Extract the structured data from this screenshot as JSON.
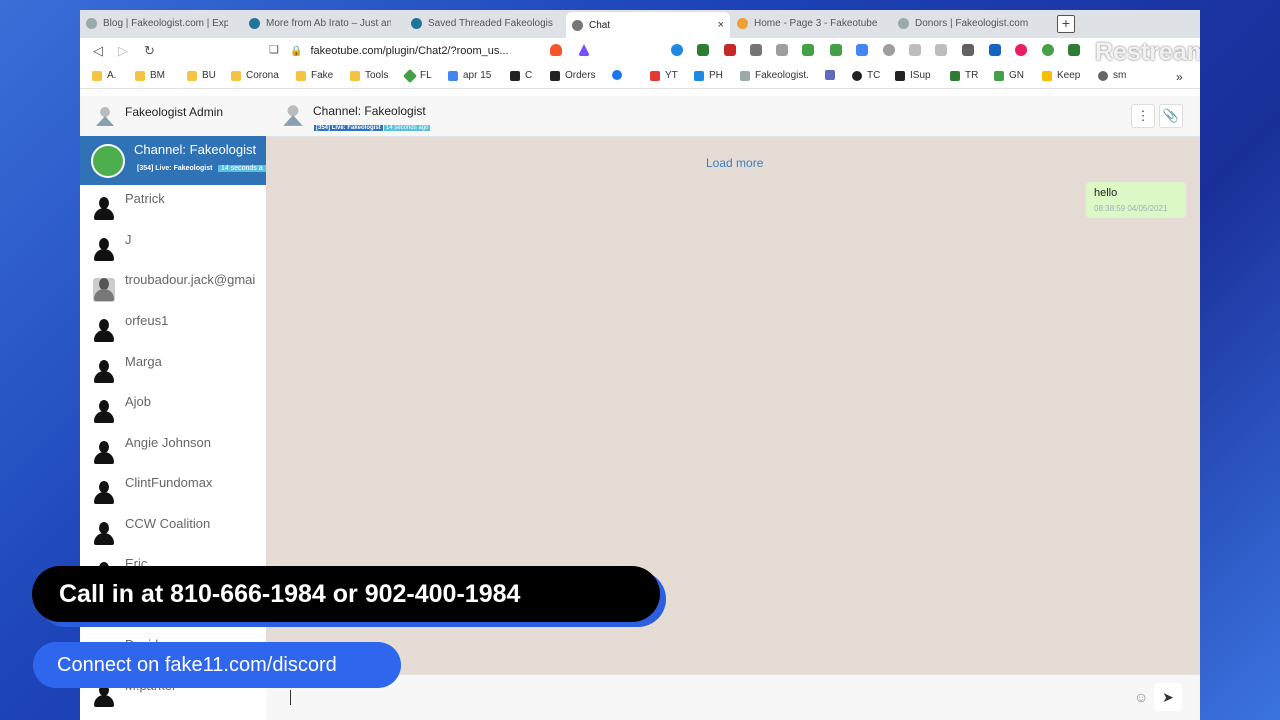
{
  "browser": {
    "tabs": [
      {
        "title": "Blog | Fakeologist.com | Exp",
        "icon": "fakeologist-icon",
        "active": false
      },
      {
        "title": "More from Ab Irato – Just an",
        "icon": "wordpress-icon",
        "active": false
      },
      {
        "title": "Saved Threaded Fakeologist",
        "icon": "wordpress-icon",
        "active": false
      },
      {
        "title": "Chat",
        "icon": "globe-icon",
        "active": true
      },
      {
        "title": "Home - Page 3 - Fakeotube -",
        "icon": "fakeotube-icon",
        "active": false
      },
      {
        "title": "Donors | Fakeologist.com",
        "icon": "fakeologist-icon",
        "active": false
      }
    ],
    "new_tab": "+",
    "close_tab": "×",
    "url": "fakeotube.com/plugin/Chat2/?room_us...",
    "restream_watermark": "Restream",
    "bookmarks": [
      "A.",
      "BM",
      "BU",
      "Corona",
      "Fake",
      "Tools",
      "FL",
      "apr 15",
      "C",
      "Orders",
      "",
      "YT",
      "PH",
      "Fakeologist.",
      "",
      "TC",
      "ISup",
      "TR",
      "GN",
      "Keep",
      "sm"
    ],
    "more_bookmarks": "»"
  },
  "sidebar": {
    "admin_name": "Fakeologist Admin",
    "channel": {
      "name": "Channel: Fakeologist",
      "sub": "[354] Live: Fakeologist",
      "badge": "14 seconds a"
    },
    "contacts": [
      {
        "name": "Patrick",
        "avatar": "silhouette"
      },
      {
        "name": "J",
        "avatar": "silhouette"
      },
      {
        "name": "troubadour.jack@gmai",
        "avatar": "photo"
      },
      {
        "name": "orfeus1",
        "avatar": "silhouette"
      },
      {
        "name": "Marga",
        "avatar": "silhouette"
      },
      {
        "name": "Ajob",
        "avatar": "silhouette"
      },
      {
        "name": "Angie Johnson",
        "avatar": "silhouette"
      },
      {
        "name": "ClintFundomax",
        "avatar": "silhouette"
      },
      {
        "name": "CCW Coalition",
        "avatar": "silhouette"
      },
      {
        "name": "Eric",
        "avatar": "silhouette"
      },
      {
        "name": "",
        "avatar": "silhouette"
      },
      {
        "name": "David",
        "avatar": "silhouette"
      },
      {
        "name": "M.parker",
        "avatar": "silhouette"
      }
    ]
  },
  "chat": {
    "title": "Channel: Fakeologist",
    "sub": "[354] Live: Fakeologist",
    "sub_badge": "14 seconds ago",
    "load_more": "Load more",
    "messages": [
      {
        "text": "hello",
        "time": "08:38:59 04/05/2021",
        "outgoing": true
      }
    ],
    "input_value": ""
  },
  "overlay": {
    "call_in": "Call in at 810-666-1984 or 902-400-1984",
    "discord": "Connect on fake11.com/discord"
  }
}
